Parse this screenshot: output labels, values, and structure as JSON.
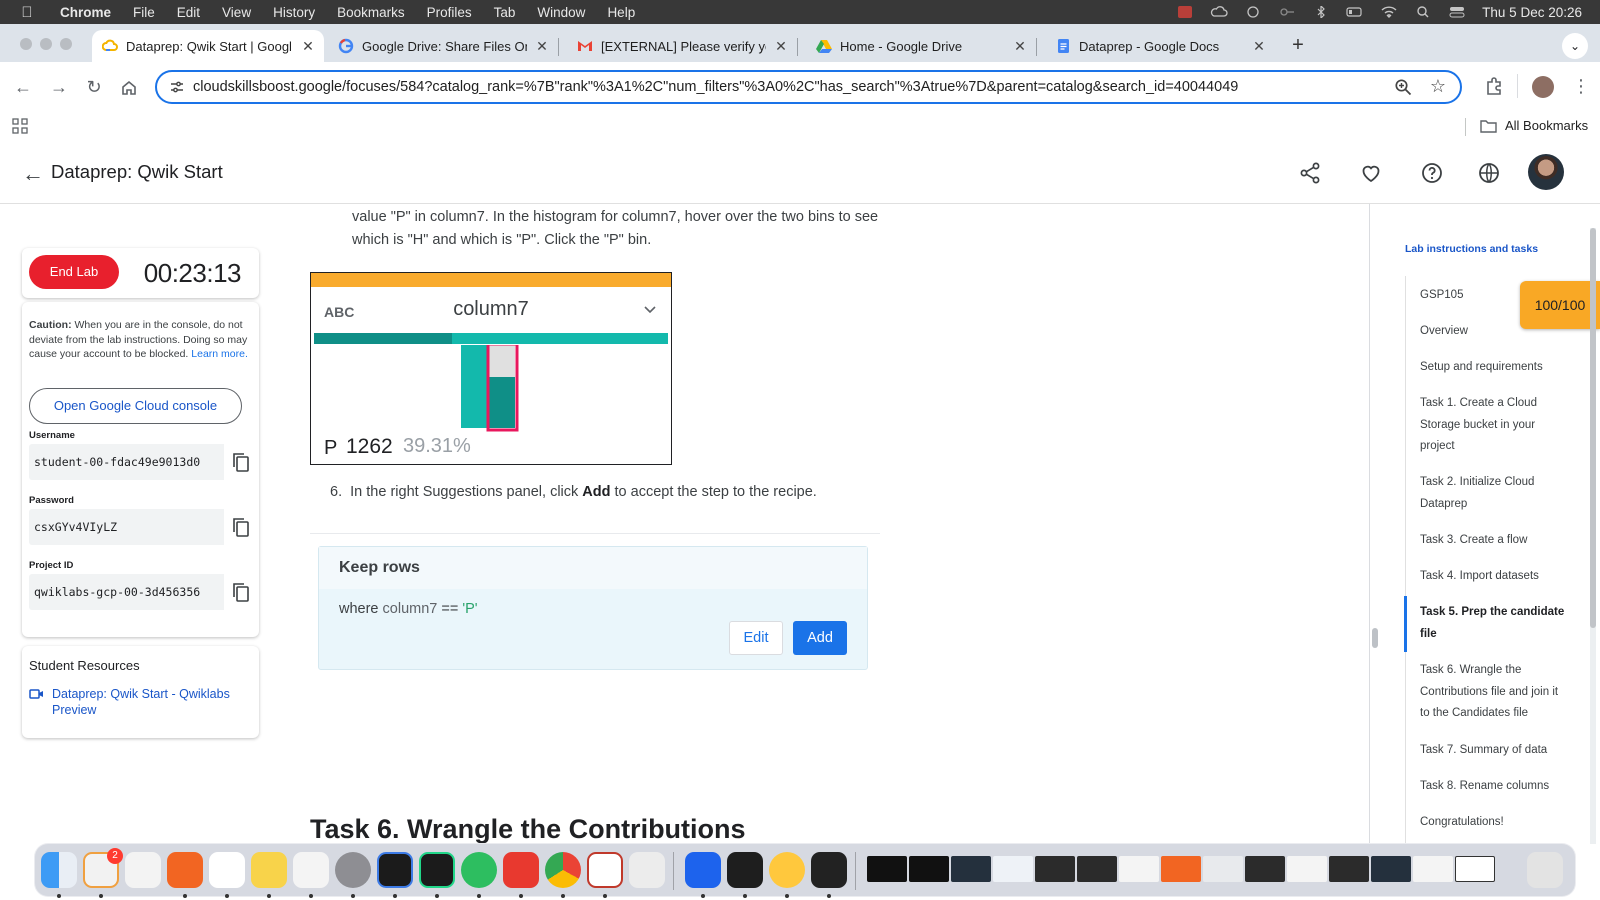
{
  "menubar": {
    "app": "Chrome",
    "items": [
      "File",
      "Edit",
      "View",
      "History",
      "Bookmarks",
      "Profiles",
      "Tab",
      "Window",
      "Help"
    ],
    "clock": "Thu 5 Dec  20:26"
  },
  "tabs": [
    {
      "label": "Dataprep: Qwik Start | Google",
      "icon": "cloud-skills-icon",
      "active": true
    },
    {
      "label": "Google Drive: Share Files Onl",
      "icon": "google-icon",
      "active": false
    },
    {
      "label": "[EXTERNAL] Please verify you",
      "icon": "gmail-icon",
      "active": false
    },
    {
      "label": "Home - Google Drive",
      "icon": "drive-icon",
      "active": false
    },
    {
      "label": "Dataprep - Google Docs",
      "icon": "docs-icon",
      "active": false
    }
  ],
  "omnibox": {
    "url": "cloudskillsboost.google/focuses/584?catalog_rank=%7B\"rank\"%3A1%2C\"num_filters\"%3A0%2C\"has_search\"%3Atrue%7D&parent=catalog&search_id=40044049"
  },
  "bookmarks": {
    "all_label": "All Bookmarks"
  },
  "header": {
    "title": "Dataprep: Qwik Start"
  },
  "lab": {
    "end_label": "End Lab",
    "timer": "00:23:13",
    "caution_bold": "Caution:",
    "caution_text": " When you are in the console, do not deviate from the lab instructions. Doing so may cause your account to be blocked. ",
    "learn_more": "Learn more.",
    "console_button": "Open Google Cloud console",
    "username_label": "Username",
    "username": "student-00-fdac49e9013d0",
    "password_label": "Password",
    "password": "csxGYv4VIyLZ",
    "project_label": "Project ID",
    "project": "qwiklabs-gcp-00-3d456356",
    "resources_title": "Student Resources",
    "resource_link": "Dataprep: Qwik Start - Qwiklabs Preview"
  },
  "content": {
    "para": "value \"P\" in column7. In the histogram for column7, hover over the two bins to see which is \"H\" and which is \"P\". Click the \"P\" bin.",
    "histogram": {
      "type_label": "ABC",
      "column": "column7",
      "value": "P",
      "count": "1262",
      "percent": "39.31%",
      "quality_fill": 0.39
    },
    "step_number": "6.",
    "step_pre": "In the right Suggestions panel, click ",
    "step_bold": "Add",
    "step_post": " to accept the step to the recipe.",
    "suggestion": {
      "title": "Keep rows",
      "where": "where",
      "col": "column7",
      "op": "==",
      "lit": "'P'",
      "edit": "Edit",
      "add": "Add"
    },
    "next_heading": "Task 6. Wrangle the Contributions"
  },
  "sidebar": {
    "title": "Lab instructions and tasks",
    "score": "100/100",
    "items": [
      {
        "label": "GSP105"
      },
      {
        "label": "Overview"
      },
      {
        "label": "Setup and requirements"
      },
      {
        "label": "Task 1. Create a Cloud Storage bucket in your project"
      },
      {
        "label": "Task 2. Initialize Cloud Dataprep"
      },
      {
        "label": "Task 3. Create a flow"
      },
      {
        "label": "Task 4. Import datasets"
      },
      {
        "label": "Task 5. Prep the candidate file"
      },
      {
        "label": "Task 6. Wrangle the Contributions file and join it to the Candidates file"
      },
      {
        "label": "Task 7. Summary of data"
      },
      {
        "label": "Task 8. Rename columns"
      },
      {
        "label": "Congratulations!"
      }
    ]
  },
  "dock": {
    "badge": "2"
  }
}
